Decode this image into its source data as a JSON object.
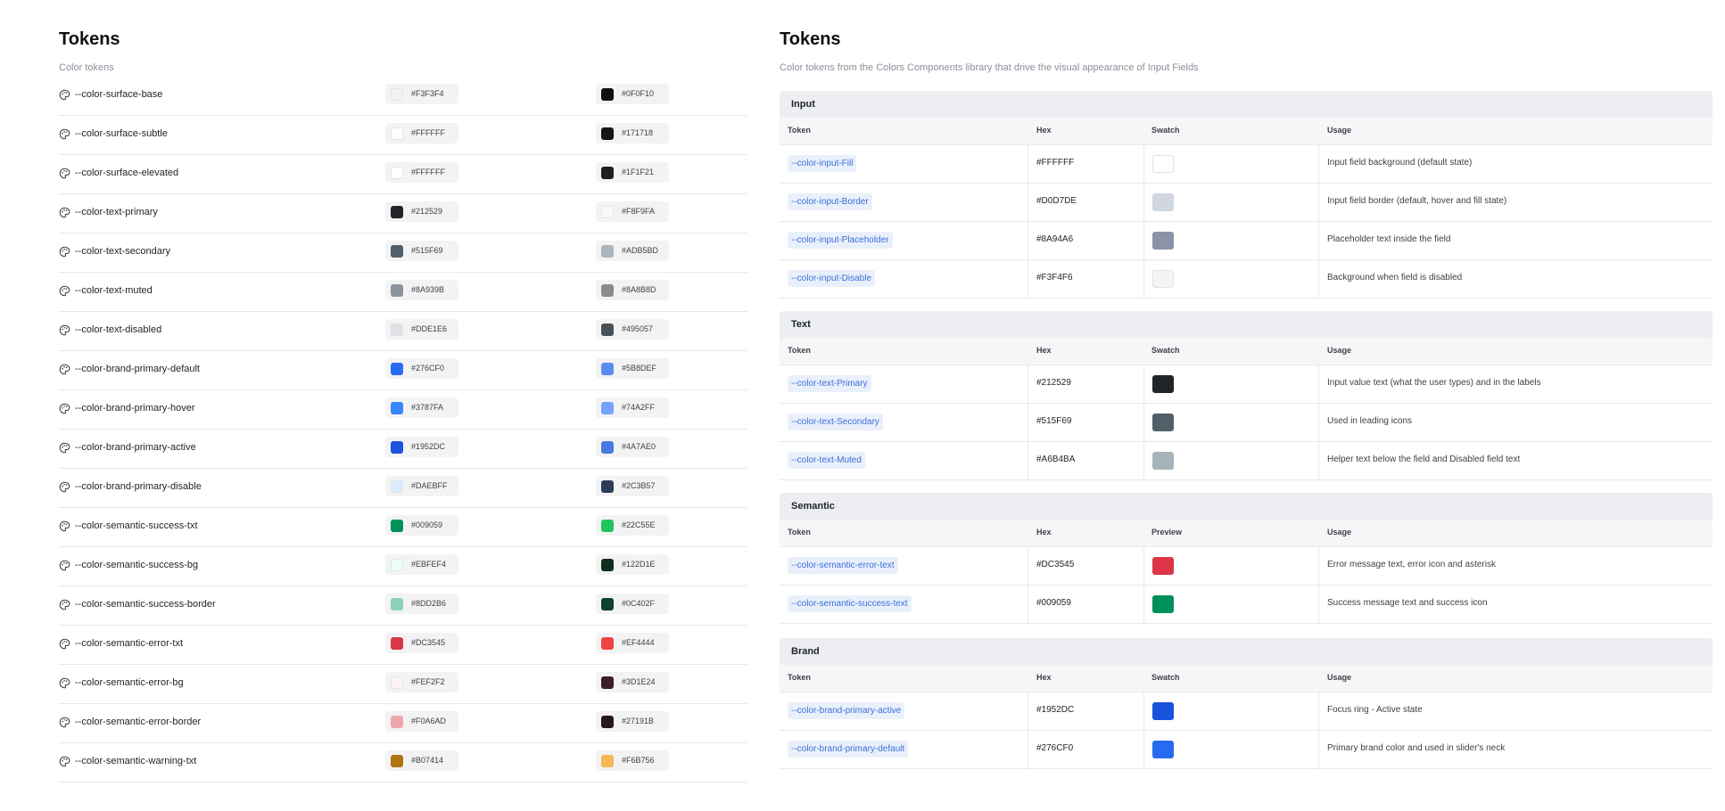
{
  "left": {
    "title": "Tokens",
    "subtitle": "Color tokens",
    "tokens": [
      {
        "name": "--color-surface-base",
        "light": "#F3F3F4",
        "dark": "#0F0F10"
      },
      {
        "name": "--color-surface-subtle",
        "light": "#FFFFFF",
        "dark": "#171718"
      },
      {
        "name": "--color-surface-elevated",
        "light": "#FFFFFF",
        "dark": "#1F1F21"
      },
      {
        "name": "--color-text-primary",
        "light": "#212529",
        "dark": "#F8F9FA"
      },
      {
        "name": "--color-text-secondary",
        "light": "#515F69",
        "dark": "#ADB5BD"
      },
      {
        "name": "--color-text-muted",
        "light": "#8A939B",
        "dark": "#8A8B8D"
      },
      {
        "name": "--color-text-disabled",
        "light": "#DDE1E6",
        "dark": "#495057"
      },
      {
        "name": "--color-brand-primary-default",
        "light": "#276CF0",
        "dark": "#5B8DEF"
      },
      {
        "name": "--color-brand-primary-hover",
        "light": "#3787FA",
        "dark": "#74A2FF"
      },
      {
        "name": "--color-brand-primary-active",
        "light": "#1952DC",
        "dark": "#4A7AE0"
      },
      {
        "name": "--color-brand-primary-disable",
        "light": "#DAEBFF",
        "dark": "#2C3B57"
      },
      {
        "name": "--color-semantic-success-txt",
        "light": "#009059",
        "dark": "#22C55E"
      },
      {
        "name": "--color-semantic-success-bg",
        "light": "#EBFEF4",
        "dark": "#122D1E"
      },
      {
        "name": "--color-semantic-success-border",
        "light": "#8DD2B6",
        "dark": "#0C402F"
      },
      {
        "name": "--color-semantic-error-txt",
        "light": "#DC3545",
        "dark": "#EF4444"
      },
      {
        "name": "--color-semantic-error-bg",
        "light": "#FEF2F2",
        "dark": "#3D1E24"
      },
      {
        "name": "--color-semantic-error-border",
        "light": "#F0A6AD",
        "dark": "#27191B"
      },
      {
        "name": "--color-semantic-warning-txt",
        "light": "#B07414",
        "dark": "#F6B756"
      }
    ]
  },
  "right": {
    "title": "Tokens",
    "subtitle": "Color tokens from the Colors Components library that drive the visual appearance of Input Fields",
    "sections": [
      {
        "title": "Input",
        "columns": [
          "Token",
          "Hex",
          "Swatch",
          "Usage"
        ],
        "rows": [
          {
            "token": "--color-input-Fill",
            "hex": "#FFFFFF",
            "color": "#FFFFFF",
            "usage": "Input field background (default state)"
          },
          {
            "token": "--color-input-Border",
            "hex": "#D0D7DE",
            "color": "#D0D7DE",
            "usage": "Input field border (default, hover and fill state)"
          },
          {
            "token": "--color-input-Placeholder",
            "hex": "#8A94A6",
            "color": "#8A94A6",
            "usage": "Placeholder text inside the field"
          },
          {
            "token": "--color-input-Disable",
            "hex": "#F3F4F6",
            "color": "#F3F4F6",
            "usage": "Background when field is disabled"
          }
        ]
      },
      {
        "title": "Text",
        "columns": [
          "Token",
          "Hex",
          "Swatch",
          "Usage"
        ],
        "rows": [
          {
            "token": "--color-text-Primary",
            "hex": "#212529",
            "color": "#212529",
            "usage": "Input value text (what the user types) and in the labels"
          },
          {
            "token": "--color-text-Secondary",
            "hex": "#515F69",
            "color": "#515F69",
            "usage": "Used in leading icons"
          },
          {
            "token": "--color-text-Muted",
            "hex": "#A6B4BA",
            "color": "#A6B4BA",
            "usage": "Helper text below the field and Disabled field text"
          }
        ]
      },
      {
        "title": "Semantic",
        "columns": [
          "Token",
          "Hex",
          "Preview",
          "Usage"
        ],
        "rows": [
          {
            "token": "--color-semantic-error-text",
            "hex": "#DC3545",
            "color": "#DC3545",
            "usage": "Error message text, error icon and asterisk"
          },
          {
            "token": "--color-semantic-success-text",
            "hex": "#009059",
            "color": "#009059",
            "usage": "Success message text and success icon"
          }
        ]
      },
      {
        "title": "Brand",
        "columns": [
          "Token",
          "Hex",
          "Swatch",
          "Usage"
        ],
        "rows": [
          {
            "token": "--color-brand-primary-active",
            "hex": "#1952DC",
            "color": "#1952DC",
            "usage": "Focus ring - Active state"
          },
          {
            "token": "--color-brand-primary-default",
            "hex": "#276CF0",
            "color": "#276CF0",
            "usage": "Primary brand color and used in slider's neck"
          }
        ]
      }
    ]
  }
}
